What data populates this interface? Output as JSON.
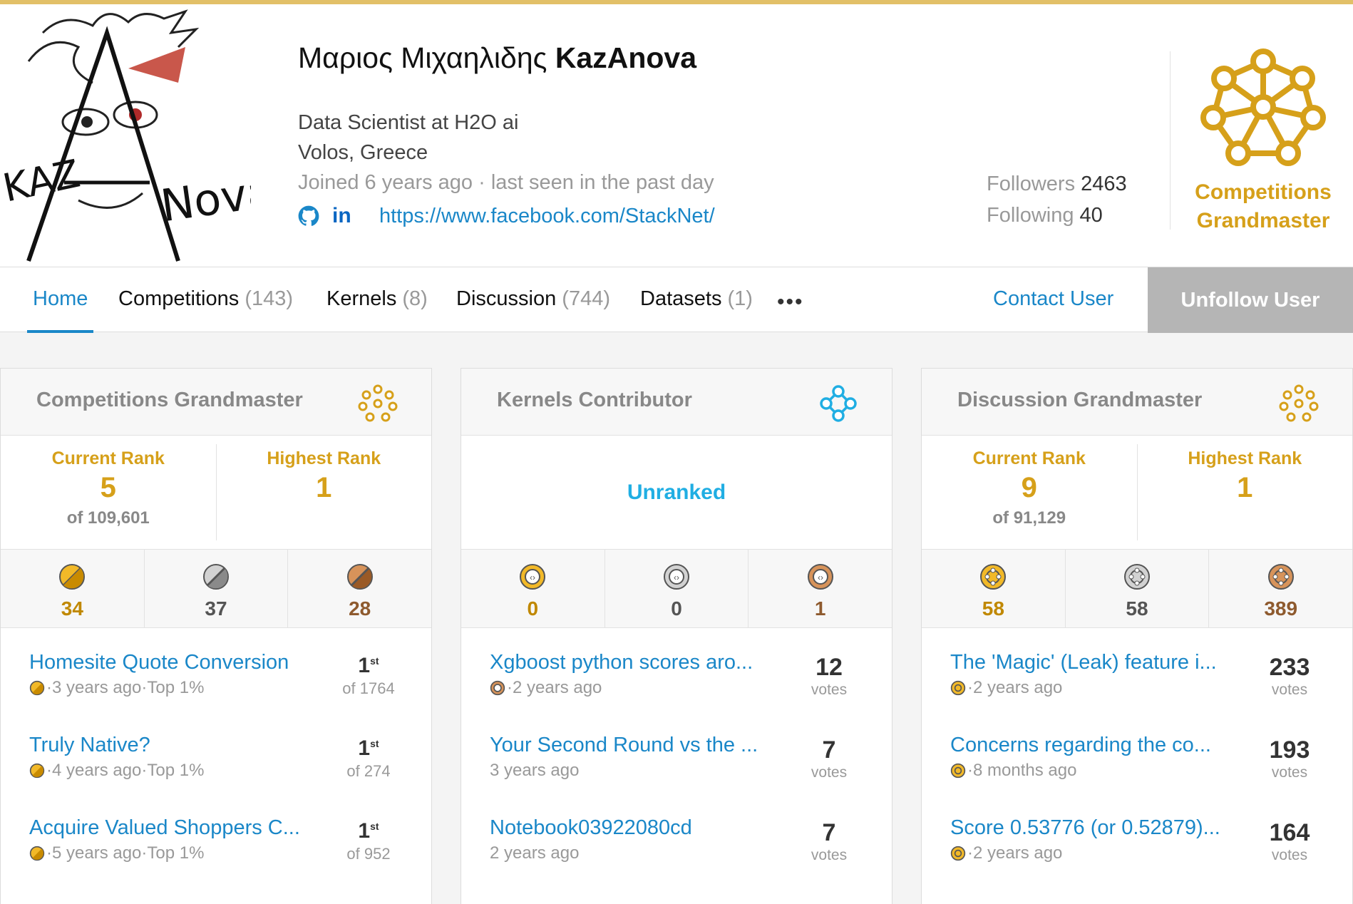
{
  "profile": {
    "display_name": "Μαριος Μιχαηλιδης",
    "username": "KazAnova",
    "occupation": "Data Scientist at H2O ai",
    "location": "Volos, Greece",
    "joined": "Joined 6 years ago · last seen in the past day",
    "website": "https://www.facebook.com/StackNet/",
    "followers_label": "Followers",
    "followers": "2463",
    "following_label": "Following",
    "following": "40",
    "tier_line1": "Competitions",
    "tier_line2": "Grandmaster",
    "avatar_text": "KAZANOVA"
  },
  "nav": {
    "tabs": [
      {
        "label": "Home",
        "count": ""
      },
      {
        "label": "Competitions",
        "count": "(143)"
      },
      {
        "label": "Kernels",
        "count": "(8)"
      },
      {
        "label": "Discussion",
        "count": "(744)"
      },
      {
        "label": "Datasets",
        "count": "(1)"
      }
    ],
    "more": "•••",
    "contact": "Contact User",
    "unfollow": "Unfollow User"
  },
  "panels": {
    "competitions": {
      "title": "Competitions Grandmaster",
      "current_rank_label": "Current Rank",
      "current_rank": "5",
      "current_of": "of 109,601",
      "highest_rank_label": "Highest Rank",
      "highest_rank": "1",
      "medals": [
        "34",
        "37",
        "28"
      ],
      "items": [
        {
          "title": "Homesite Quote Conversion",
          "sub": "·3 years ago·Top 1%",
          "place": "1",
          "suffix": "st",
          "of": "of 1764"
        },
        {
          "title": "Truly Native?",
          "sub": "·4 years ago·Top 1%",
          "place": "1",
          "suffix": "st",
          "of": "of 274"
        },
        {
          "title": "Acquire Valued Shoppers C...",
          "sub": "·5 years ago·Top 1%",
          "place": "1",
          "suffix": "st",
          "of": "of 952"
        }
      ]
    },
    "kernels": {
      "title": "Kernels Contributor",
      "unranked": "Unranked",
      "medals": [
        "0",
        "0",
        "1"
      ],
      "items": [
        {
          "title": "Xgboost python scores aro...",
          "sub": "·2 years ago",
          "votes": "12",
          "votes_label": "votes"
        },
        {
          "title": "Your Second Round vs the ...",
          "sub": "3 years ago",
          "votes": "7",
          "votes_label": "votes"
        },
        {
          "title": "Notebook03922080cd",
          "sub": "2 years ago",
          "votes": "7",
          "votes_label": "votes"
        }
      ]
    },
    "discussion": {
      "title": "Discussion Grandmaster",
      "current_rank_label": "Current Rank",
      "current_rank": "9",
      "current_of": "of 91,129",
      "highest_rank_label": "Highest Rank",
      "highest_rank": "1",
      "medals": [
        "58",
        "58",
        "389"
      ],
      "items": [
        {
          "title": "The 'Magic' (Leak) feature i...",
          "sub": "·2 years ago",
          "votes": "233",
          "votes_label": "votes"
        },
        {
          "title": "Concerns regarding the co...",
          "sub": "·8 months ago",
          "votes": "193",
          "votes_label": "votes"
        },
        {
          "title": "Score 0.53776 (or 0.52879)...",
          "sub": "·2 years ago",
          "votes": "164",
          "votes_label": "votes"
        }
      ]
    }
  },
  "colors": {
    "accent": "#1a87c8",
    "gold": "#d6a01a",
    "silver": "#8a8a8a",
    "bronze": "#8e5a2e",
    "kernels_blue": "#20aee3"
  }
}
